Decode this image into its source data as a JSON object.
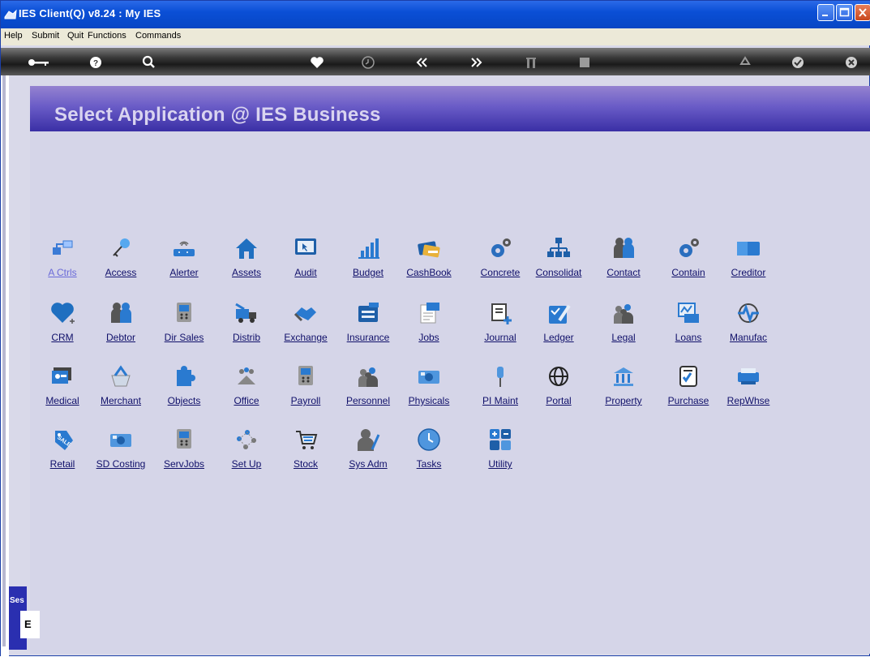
{
  "window": {
    "title": "IES Client(Q) v8.24 : My IES"
  },
  "menu": [
    "Help",
    "Submit",
    "Quit",
    "Functions",
    "Commands"
  ],
  "toolbar": {
    "icons": [
      "key-icon",
      "help-icon",
      "search-icon",
      "heart-icon",
      "clock-icon",
      "rewind-icon",
      "forward-icon",
      "tools-icon",
      "stop-icon",
      "recycle-icon",
      "check-icon",
      "close-icon"
    ]
  },
  "panel": {
    "title": "Select Application @  IES Business"
  },
  "session": {
    "label": "Ses",
    "value": "E"
  },
  "apps": [
    {
      "label": "A Ctrls",
      "icon": "network-icon"
    },
    {
      "label": "Access",
      "icon": "key-icon"
    },
    {
      "label": "Alerter",
      "icon": "router-icon"
    },
    {
      "label": "Assets",
      "icon": "house-icon"
    },
    {
      "label": "Audit",
      "icon": "monitor-icon"
    },
    {
      "label": "Budget",
      "icon": "bar-chart-icon"
    },
    {
      "label": "CashBook",
      "icon": "credit-card-icon"
    },
    {
      "label": "Concrete",
      "icon": "gears-icon"
    },
    {
      "label": "Consolidat",
      "icon": "org-chart-icon"
    },
    {
      "label": "Contact",
      "icon": "people-icon"
    },
    {
      "label": "Contain",
      "icon": "gears-icon"
    },
    {
      "label": "Creditor",
      "icon": "card-icon"
    },
    {
      "label": "CRM",
      "icon": "heart-icon"
    },
    {
      "label": "Debtor",
      "icon": "people-icon"
    },
    {
      "label": "Dir Sales",
      "icon": "phone-icon"
    },
    {
      "label": "Distrib",
      "icon": "truck-icon"
    },
    {
      "label": "Exchange",
      "icon": "handshake-icon"
    },
    {
      "label": "Insurance",
      "icon": "cabinet-icon"
    },
    {
      "label": "Jobs",
      "icon": "document-icon"
    },
    {
      "label": "Journal",
      "icon": "journal-icon"
    },
    {
      "label": "Ledger",
      "icon": "ledger-icon"
    },
    {
      "label": "Legal",
      "icon": "group-icon"
    },
    {
      "label": "Loans",
      "icon": "loans-icon"
    },
    {
      "label": "Manufac",
      "icon": "pulse-icon"
    },
    {
      "label": "Medical",
      "icon": "medical-icon"
    },
    {
      "label": "Merchant",
      "icon": "basket-icon"
    },
    {
      "label": "Objects",
      "icon": "puzzle-icon"
    },
    {
      "label": "Office",
      "icon": "office-icon"
    },
    {
      "label": "Payroll",
      "icon": "phone-icon"
    },
    {
      "label": "Personnel",
      "icon": "group-icon"
    },
    {
      "label": "Physicals",
      "icon": "camera-icon"
    },
    {
      "label": "PI Maint",
      "icon": "pin-icon"
    },
    {
      "label": "Portal",
      "icon": "globe-icon"
    },
    {
      "label": "Property",
      "icon": "bank-icon"
    },
    {
      "label": "Purchase",
      "icon": "checklist-icon"
    },
    {
      "label": "RepWhse",
      "icon": "printer-icon"
    },
    {
      "label": "Retail",
      "icon": "sale-tag-icon"
    },
    {
      "label": "SD Costing",
      "icon": "camera-icon"
    },
    {
      "label": "ServJobs",
      "icon": "phone-icon"
    },
    {
      "label": "Set Up",
      "icon": "diagram-icon"
    },
    {
      "label": "Stock",
      "icon": "cart-icon"
    },
    {
      "label": "Sys Adm",
      "icon": "admin-icon"
    },
    {
      "label": "Tasks",
      "icon": "clock-icon"
    },
    {
      "label": "Utility",
      "icon": "utility-icon"
    }
  ]
}
